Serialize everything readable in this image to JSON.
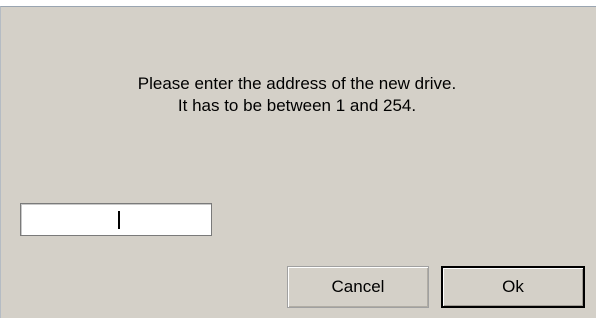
{
  "dialog": {
    "message_line_1": "Please enter the address of the new drive.",
    "message_line_2": "It has to be between 1 and 254."
  },
  "address_input": {
    "value": ""
  },
  "buttons": {
    "cancel_label": "Cancel",
    "ok_label": "Ok"
  },
  "colors": {
    "dialog_background": "#d4d0c8",
    "input_background": "#ffffff",
    "default_button_border": "#000000"
  }
}
